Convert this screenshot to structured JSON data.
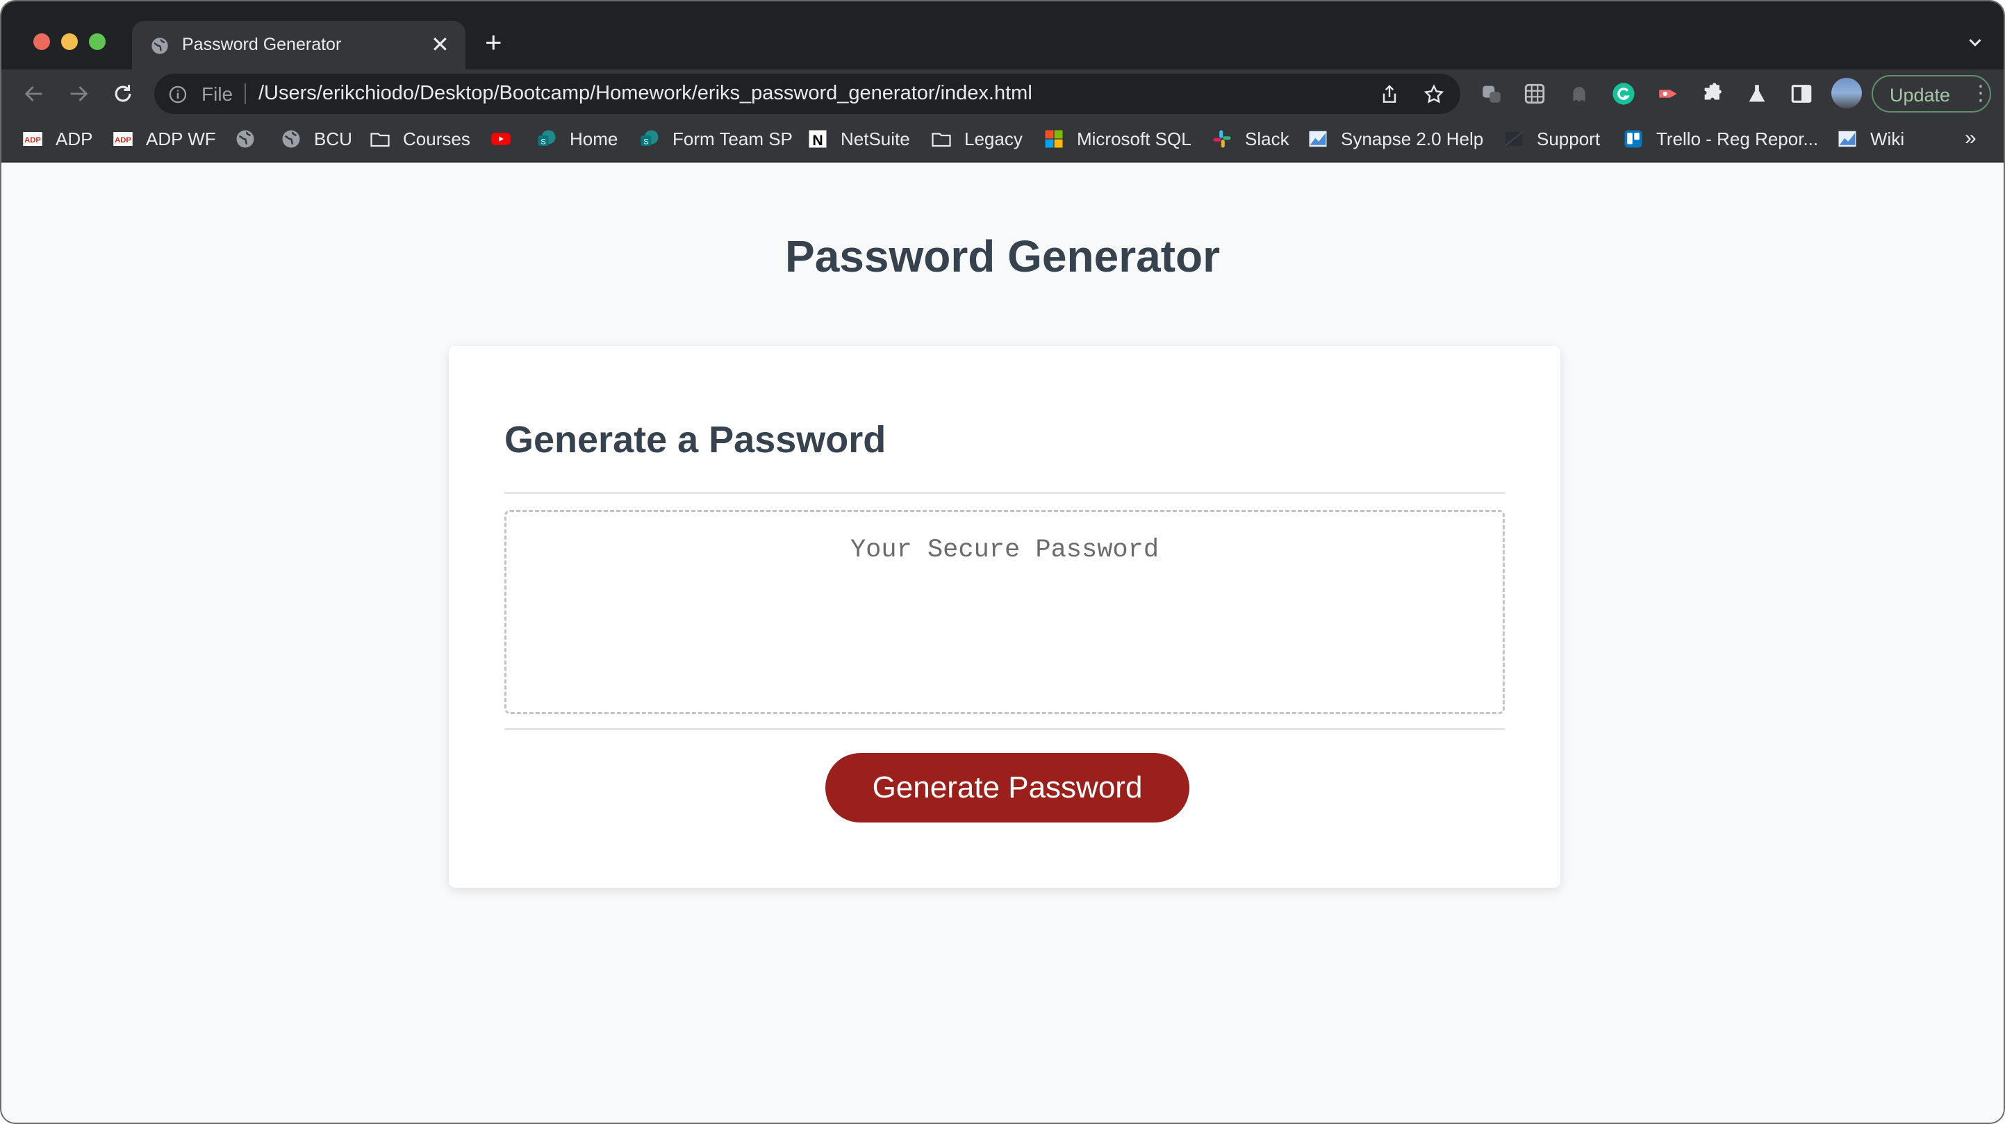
{
  "browser": {
    "tab": {
      "title": "Password Generator",
      "close_glyph": "✕",
      "icon": "globe-icon"
    },
    "new_tab_glyph": "+",
    "address_bar": {
      "scheme_label": "File",
      "url": "/Users/erikchiodo/Desktop/Bootcamp/Homework/eriks_password_generator/index.html"
    },
    "update_button": {
      "label": "Update",
      "menu_glyph": "⋮"
    },
    "bookmarks": [
      {
        "label": "ADP",
        "icon": "adp-icon"
      },
      {
        "label": "ADP WF",
        "icon": "adp-icon"
      },
      {
        "label": "",
        "icon": "globe-icon"
      },
      {
        "label": "BCU",
        "icon": "globe-icon"
      },
      {
        "label": "Courses",
        "icon": "folder-icon"
      },
      {
        "label": "",
        "icon": "youtube-icon"
      },
      {
        "label": "Home",
        "icon": "sharepoint-icon"
      },
      {
        "label": "Form Team SP",
        "icon": "sharepoint-icon"
      },
      {
        "label": "NetSuite",
        "icon": "netsuite-icon"
      },
      {
        "label": "Legacy",
        "icon": "folder-icon"
      },
      {
        "label": "Microsoft SQL",
        "icon": "microsoft-icon"
      },
      {
        "label": "Slack",
        "icon": "slack-icon"
      },
      {
        "label": "Synapse 2.0 Help",
        "icon": "chart-icon"
      },
      {
        "label": "Support",
        "icon": "support-icon"
      },
      {
        "label": "Trello - Reg Repor...",
        "icon": "trello-icon"
      },
      {
        "label": "Wiki",
        "icon": "chart-icon"
      }
    ],
    "bookmarks_overflow": "»"
  },
  "page": {
    "title": "Password Generator",
    "card": {
      "heading": "Generate a Password",
      "password_placeholder": "Your Secure Password",
      "password_value": "",
      "generate_button": "Generate Password"
    }
  },
  "colors": {
    "accent_button": "#9b1f1a",
    "heading_text": "#36434f",
    "page_background": "#f8f9fa"
  }
}
